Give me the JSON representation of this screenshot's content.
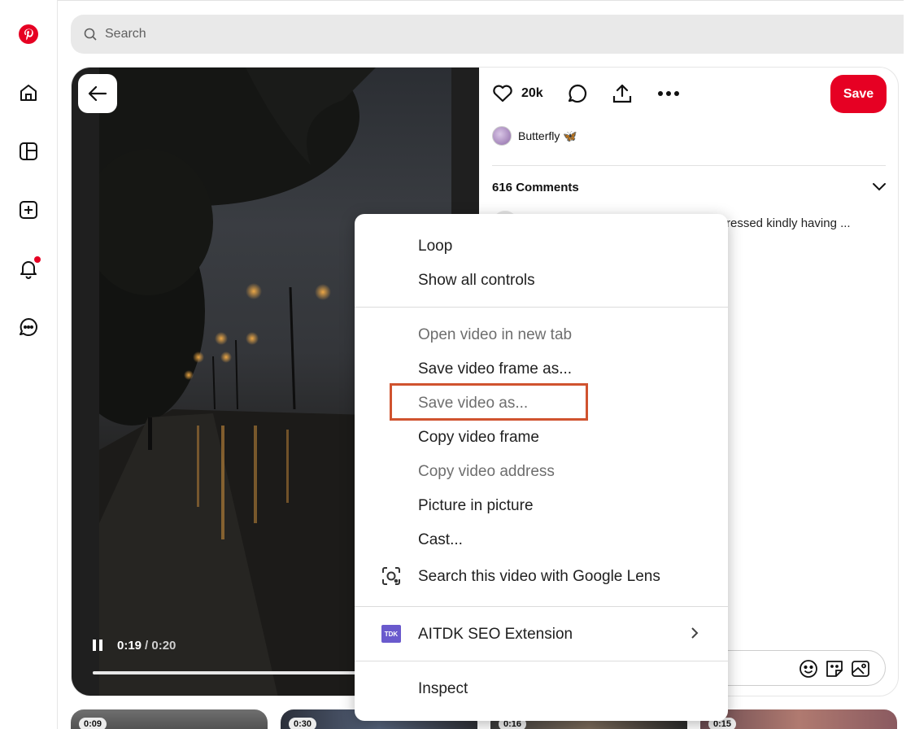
{
  "search": {
    "placeholder": "Search"
  },
  "sidebar": {
    "items": [
      {
        "icon": "pinterest-logo-icon"
      },
      {
        "icon": "home-icon"
      },
      {
        "icon": "explore-icon"
      },
      {
        "icon": "create-icon"
      },
      {
        "icon": "notifications-icon"
      },
      {
        "icon": "messages-icon"
      }
    ],
    "notification_color": "#e60023"
  },
  "pin": {
    "likes": "20k",
    "save_label": "Save",
    "creator": "Butterfly 🦋",
    "comments_title": "616 Comments",
    "comment_preview": "ressed kindly having ...",
    "accent": "#e60023"
  },
  "video": {
    "current_time": "0:19",
    "total_time": "/ 0:20",
    "progress": 0.95
  },
  "thumbnails": [
    {
      "duration": "0:09"
    },
    {
      "duration": "0:30"
    },
    {
      "duration": "0:16"
    },
    {
      "duration": "0:15"
    }
  ],
  "context_menu": {
    "loop": "Loop",
    "show_controls": "Show all controls",
    "open_new_tab": "Open video in new tab",
    "save_frame": "Save video frame as...",
    "save_video": "Save video as...",
    "copy_frame": "Copy video frame",
    "copy_address": "Copy video address",
    "pip": "Picture in picture",
    "cast": "Cast...",
    "lens": "Search this video with Google Lens",
    "extension": "AITDK SEO Extension",
    "extension_badge": "TDK",
    "inspect": "Inspect",
    "highlight_color": "#d0532f"
  }
}
